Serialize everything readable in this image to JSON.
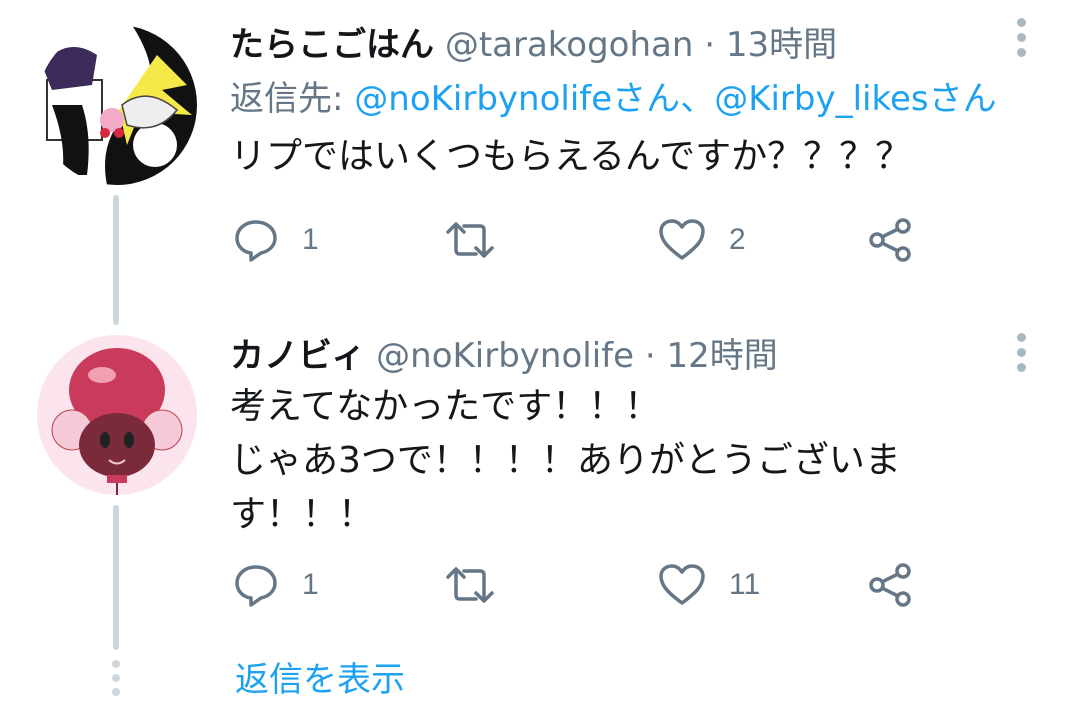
{
  "tweets": [
    {
      "display_name": "たらこごはん",
      "handle": "@tarakogohan",
      "separator": "·",
      "time": "13時間",
      "reply_to_label": "返信先:",
      "reply_to_user1": "@noKirbynolifeさん",
      "reply_to_comma": "、",
      "reply_to_user2": "@Kirby_likesさん",
      "text_lines": [
        "リプではいくつもらえるんですか？？？？"
      ],
      "reply_count": "1",
      "retweet_count": "",
      "like_count": "2",
      "avatar_icon": "black-white-character-avatar"
    },
    {
      "display_name": "カノビィ",
      "handle": "@noKirbynolife",
      "separator": "·",
      "time": "12時間",
      "text_lines": [
        "考えてなかったです！！！",
        "じゃあ3つで！！！！ありがとうございま",
        "す！！！"
      ],
      "reply_count": "1",
      "retweet_count": "",
      "like_count": "11",
      "avatar_icon": "pink-kirby-avatar"
    }
  ],
  "show_replies_label": "返信を表示",
  "colors": {
    "link": "#1da1f2",
    "secondary": "#657786",
    "thread_line": "#ccd6dd"
  }
}
